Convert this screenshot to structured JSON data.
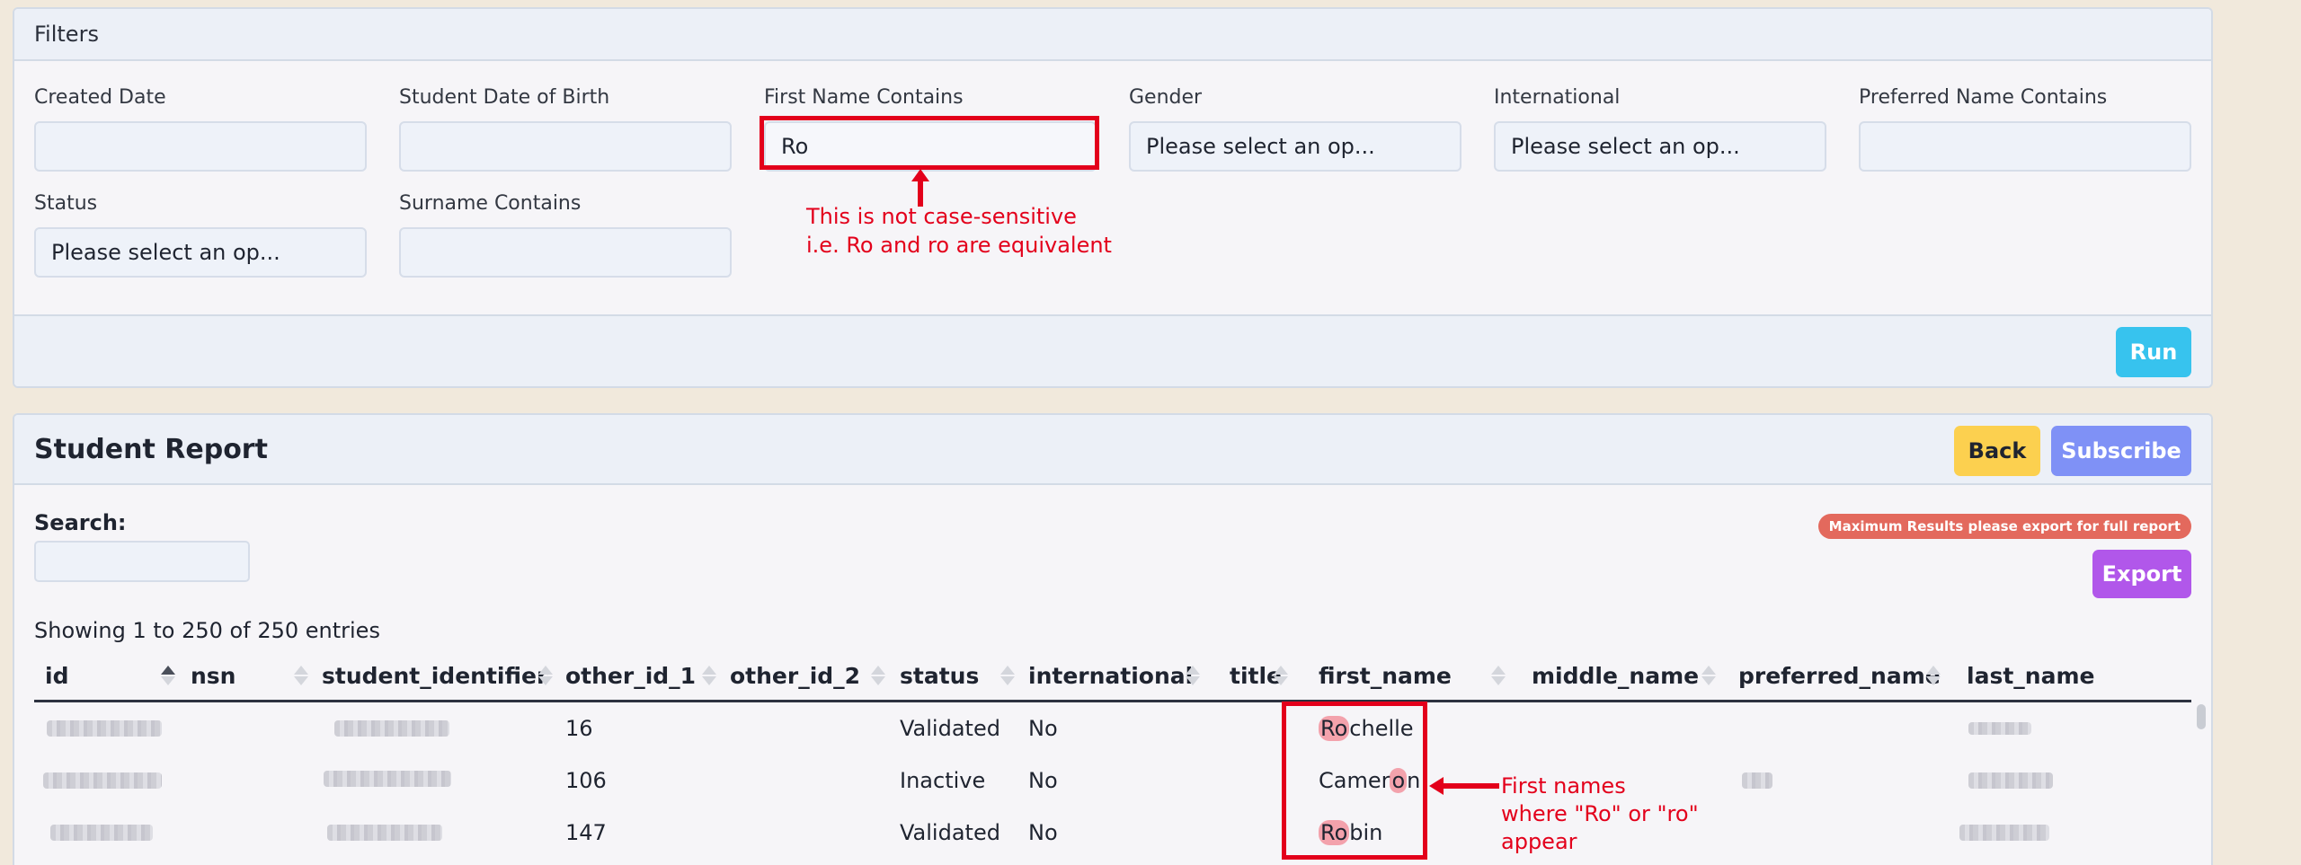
{
  "filters": {
    "title": "Filters",
    "fields": {
      "created_date": {
        "label": "Created Date",
        "value": ""
      },
      "dob": {
        "label": "Student Date of Birth",
        "value": ""
      },
      "first_name": {
        "label": "First Name Contains",
        "value": "Ro"
      },
      "gender": {
        "label": "Gender",
        "value": "Please select an op..."
      },
      "international": {
        "label": "International",
        "value": "Please select an op..."
      },
      "preferred_name": {
        "label": "Preferred Name Contains",
        "value": ""
      },
      "status": {
        "label": "Status",
        "value": "Please select an op..."
      },
      "surname": {
        "label": "Surname Contains",
        "value": ""
      }
    },
    "run_label": "Run"
  },
  "report": {
    "title": "Student Report",
    "back_label": "Back",
    "subscribe_label": "Subscribe",
    "search_label": "Search:",
    "max_badge": "Maximum Results please export for full report",
    "export_label": "Export",
    "entries_info": "Showing 1 to 250 of 250 entries",
    "columns": [
      "id",
      "nsn",
      "student_identifier",
      "other_id_1",
      "other_id_2",
      "status",
      "international",
      "title",
      "first_name",
      "middle_name",
      "preferred_name",
      "last_name"
    ],
    "rows": [
      {
        "other_id_1": "16",
        "status": "Validated",
        "international": "No",
        "first_name_hl": "Ro",
        "first_name_rest": "chelle"
      },
      {
        "other_id_1": "106",
        "status": "Inactive",
        "international": "No",
        "first_name_pre": "Camer",
        "first_name_hl": "o",
        "first_name_rest": "n"
      },
      {
        "other_id_1": "147",
        "status": "Validated",
        "international": "No",
        "first_name_hl": "Ro",
        "first_name_rest": "bin"
      }
    ]
  },
  "annotations": {
    "case_note_line1": "This is not case-sensitive",
    "case_note_line2": "i.e. Ro and ro are equivalent",
    "names_note_line1": "First names",
    "names_note_line2": "where \"Ro\" or \"ro\"",
    "names_note_line3": "appear",
    "color": "#e3001b"
  },
  "colors": {
    "run": "#37c3ee",
    "back": "#fcd04f",
    "subscribe": "#7f91f6",
    "export": "#b157ea",
    "badge": "#e3695d"
  }
}
